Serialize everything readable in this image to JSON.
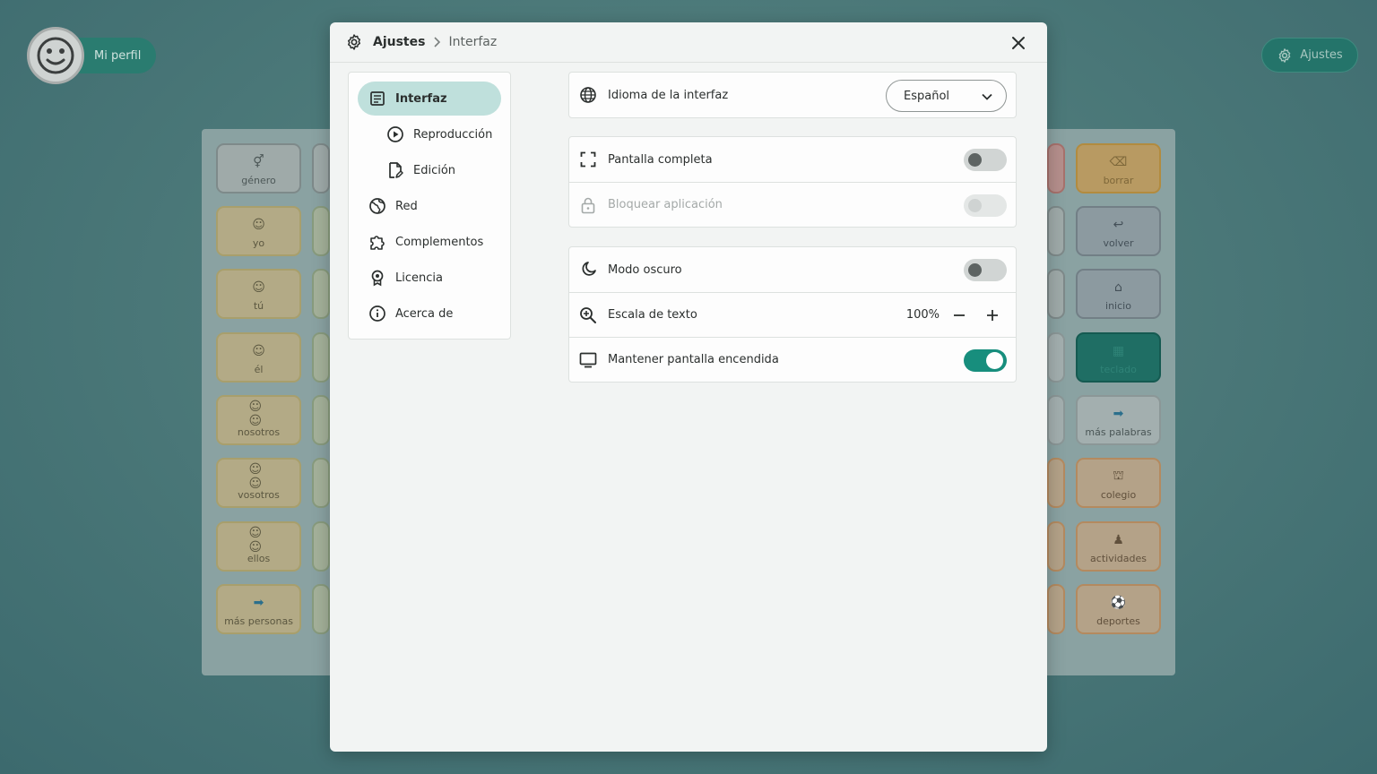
{
  "background": {
    "profile": {
      "name": "Mi perfil"
    },
    "settings_button": {
      "label": "Ajustes"
    },
    "board_cells": [
      {
        "label": "género"
      },
      {
        "label": "yo"
      },
      {
        "label": "tú"
      },
      {
        "label": "él"
      },
      {
        "label": "nosotros"
      },
      {
        "label": "vosotros"
      },
      {
        "label": "ellos"
      },
      {
        "label": "más personas"
      },
      {
        "label": "borrar"
      },
      {
        "label": "volver"
      },
      {
        "label": "inicio"
      },
      {
        "label": "teclado"
      },
      {
        "label": "más palabras"
      },
      {
        "label": "colegio"
      },
      {
        "label": "actividades"
      },
      {
        "label": "deportes"
      }
    ]
  },
  "modal": {
    "breadcrumb": {
      "root": "Ajustes",
      "current": "Interfaz"
    },
    "nav": [
      {
        "label": "Interfaz",
        "icon": "layout-icon",
        "active": true
      },
      {
        "label": "Reproducción",
        "icon": "play-circle-icon"
      },
      {
        "label": "Edición",
        "icon": "edit-file-icon"
      },
      {
        "label": "Red",
        "icon": "globe-icon"
      },
      {
        "label": "Complementos",
        "icon": "puzzle-icon"
      },
      {
        "label": "Licencia",
        "icon": "award-icon"
      },
      {
        "label": "Acerca de",
        "icon": "info-icon"
      }
    ],
    "language": {
      "label": "Idioma de la interfaz",
      "value": "Español"
    },
    "fullscreen": {
      "label": "Pantalla completa",
      "on": false
    },
    "lock_app": {
      "label": "Bloquear aplicación",
      "on": false,
      "disabled": true
    },
    "dark_mode": {
      "label": "Modo oscuro",
      "on": false
    },
    "text_scale": {
      "label": "Escala de texto",
      "value": "100%"
    },
    "keep_screen_on": {
      "label": "Mantener pantalla encendida",
      "on": true
    },
    "accent_color": "#178e7d"
  }
}
